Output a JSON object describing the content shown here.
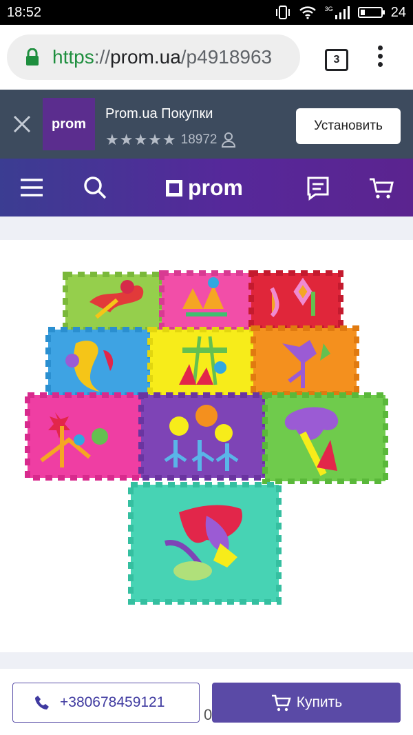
{
  "status_bar": {
    "time": "18:52",
    "battery": "24",
    "network": "3G",
    "battery_level": 0.24
  },
  "browser": {
    "url_scheme": "https",
    "url_sep": "://",
    "url_host": "prom.ua",
    "url_path": "/p4918963",
    "tab_count": "3"
  },
  "app_banner": {
    "title": "Prom.ua Покупки",
    "stars": "★★★★★",
    "rating_count": "18972",
    "install_label": "Установить",
    "icon_text": "prom"
  },
  "header": {
    "logo_text": "prom"
  },
  "product": {
    "image_alt": "Puzzle floor mat with flowers"
  },
  "bottom_bar": {
    "phone": "+380678459121",
    "buy_label": "Купить"
  },
  "peek_text": "0",
  "colors": {
    "header_gradient_start": "#3b3d92",
    "header_gradient_end": "#5b248f",
    "banner_bg": "#3d4b5e",
    "buy_button": "#5a4aa6",
    "url_scheme": "#1e8e3e"
  }
}
